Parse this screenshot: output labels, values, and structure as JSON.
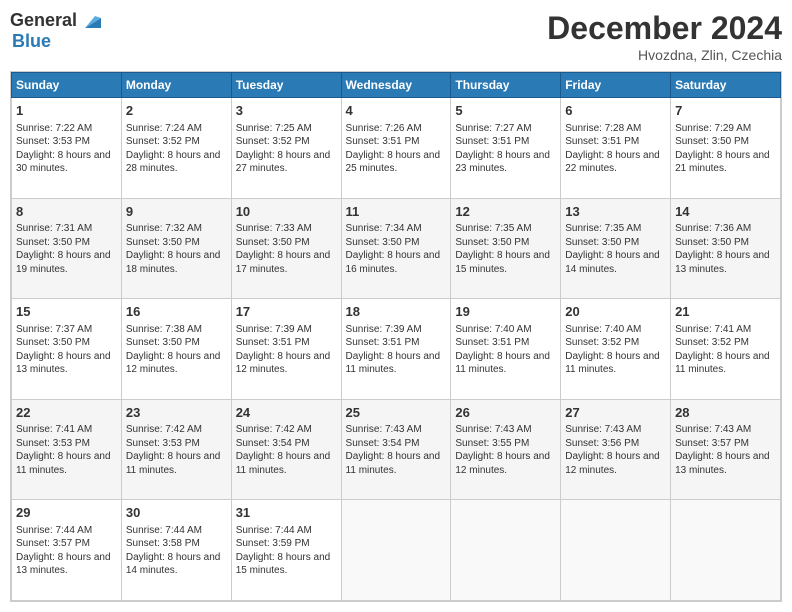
{
  "header": {
    "logo_general": "General",
    "logo_blue": "Blue",
    "title": "December 2024",
    "location": "Hvozdna, Zlin, Czechia"
  },
  "days_of_week": [
    "Sunday",
    "Monday",
    "Tuesday",
    "Wednesday",
    "Thursday",
    "Friday",
    "Saturday"
  ],
  "weeks": [
    [
      {
        "day": 1,
        "sunrise": "7:22 AM",
        "sunset": "3:53 PM",
        "daylight": "8 hours and 30 minutes."
      },
      {
        "day": 2,
        "sunrise": "7:24 AM",
        "sunset": "3:52 PM",
        "daylight": "8 hours and 28 minutes."
      },
      {
        "day": 3,
        "sunrise": "7:25 AM",
        "sunset": "3:52 PM",
        "daylight": "8 hours and 27 minutes."
      },
      {
        "day": 4,
        "sunrise": "7:26 AM",
        "sunset": "3:51 PM",
        "daylight": "8 hours and 25 minutes."
      },
      {
        "day": 5,
        "sunrise": "7:27 AM",
        "sunset": "3:51 PM",
        "daylight": "8 hours and 23 minutes."
      },
      {
        "day": 6,
        "sunrise": "7:28 AM",
        "sunset": "3:51 PM",
        "daylight": "8 hours and 22 minutes."
      },
      {
        "day": 7,
        "sunrise": "7:29 AM",
        "sunset": "3:50 PM",
        "daylight": "8 hours and 21 minutes."
      }
    ],
    [
      {
        "day": 8,
        "sunrise": "7:31 AM",
        "sunset": "3:50 PM",
        "daylight": "8 hours and 19 minutes."
      },
      {
        "day": 9,
        "sunrise": "7:32 AM",
        "sunset": "3:50 PM",
        "daylight": "8 hours and 18 minutes."
      },
      {
        "day": 10,
        "sunrise": "7:33 AM",
        "sunset": "3:50 PM",
        "daylight": "8 hours and 17 minutes."
      },
      {
        "day": 11,
        "sunrise": "7:34 AM",
        "sunset": "3:50 PM",
        "daylight": "8 hours and 16 minutes."
      },
      {
        "day": 12,
        "sunrise": "7:35 AM",
        "sunset": "3:50 PM",
        "daylight": "8 hours and 15 minutes."
      },
      {
        "day": 13,
        "sunrise": "7:35 AM",
        "sunset": "3:50 PM",
        "daylight": "8 hours and 14 minutes."
      },
      {
        "day": 14,
        "sunrise": "7:36 AM",
        "sunset": "3:50 PM",
        "daylight": "8 hours and 13 minutes."
      }
    ],
    [
      {
        "day": 15,
        "sunrise": "7:37 AM",
        "sunset": "3:50 PM",
        "daylight": "8 hours and 13 minutes."
      },
      {
        "day": 16,
        "sunrise": "7:38 AM",
        "sunset": "3:50 PM",
        "daylight": "8 hours and 12 minutes."
      },
      {
        "day": 17,
        "sunrise": "7:39 AM",
        "sunset": "3:51 PM",
        "daylight": "8 hours and 12 minutes."
      },
      {
        "day": 18,
        "sunrise": "7:39 AM",
        "sunset": "3:51 PM",
        "daylight": "8 hours and 11 minutes."
      },
      {
        "day": 19,
        "sunrise": "7:40 AM",
        "sunset": "3:51 PM",
        "daylight": "8 hours and 11 minutes."
      },
      {
        "day": 20,
        "sunrise": "7:40 AM",
        "sunset": "3:52 PM",
        "daylight": "8 hours and 11 minutes."
      },
      {
        "day": 21,
        "sunrise": "7:41 AM",
        "sunset": "3:52 PM",
        "daylight": "8 hours and 11 minutes."
      }
    ],
    [
      {
        "day": 22,
        "sunrise": "7:41 AM",
        "sunset": "3:53 PM",
        "daylight": "8 hours and 11 minutes."
      },
      {
        "day": 23,
        "sunrise": "7:42 AM",
        "sunset": "3:53 PM",
        "daylight": "8 hours and 11 minutes."
      },
      {
        "day": 24,
        "sunrise": "7:42 AM",
        "sunset": "3:54 PM",
        "daylight": "8 hours and 11 minutes."
      },
      {
        "day": 25,
        "sunrise": "7:43 AM",
        "sunset": "3:54 PM",
        "daylight": "8 hours and 11 minutes."
      },
      {
        "day": 26,
        "sunrise": "7:43 AM",
        "sunset": "3:55 PM",
        "daylight": "8 hours and 12 minutes."
      },
      {
        "day": 27,
        "sunrise": "7:43 AM",
        "sunset": "3:56 PM",
        "daylight": "8 hours and 12 minutes."
      },
      {
        "day": 28,
        "sunrise": "7:43 AM",
        "sunset": "3:57 PM",
        "daylight": "8 hours and 13 minutes."
      }
    ],
    [
      {
        "day": 29,
        "sunrise": "7:44 AM",
        "sunset": "3:57 PM",
        "daylight": "8 hours and 13 minutes."
      },
      {
        "day": 30,
        "sunrise": "7:44 AM",
        "sunset": "3:58 PM",
        "daylight": "8 hours and 14 minutes."
      },
      {
        "day": 31,
        "sunrise": "7:44 AM",
        "sunset": "3:59 PM",
        "daylight": "8 hours and 15 minutes."
      },
      null,
      null,
      null,
      null
    ]
  ]
}
